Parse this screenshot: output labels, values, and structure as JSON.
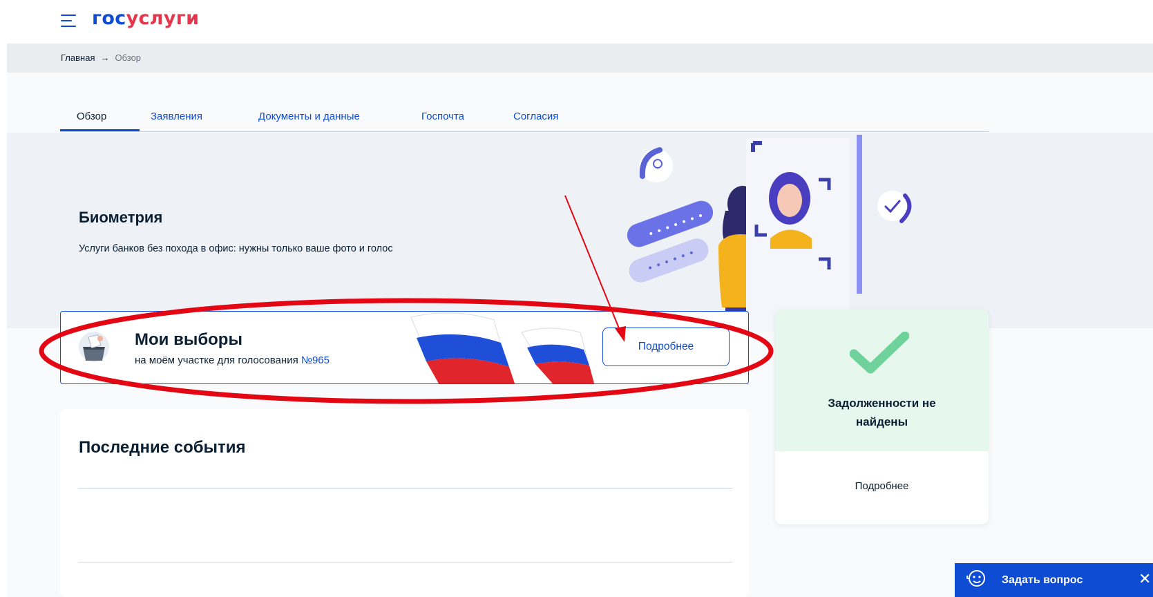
{
  "header": {
    "logo_part1": "гос",
    "logo_part2": "услуги",
    "menu_icon": "burger-menu-icon"
  },
  "breadcrumb": {
    "home": "Главная",
    "separator": "→",
    "current": "Обзор"
  },
  "tabs": [
    {
      "label": "Обзор",
      "active": true
    },
    {
      "label": "Заявления"
    },
    {
      "label": "Документы и данные"
    },
    {
      "label": "Госпочта"
    },
    {
      "label": "Согласия"
    }
  ],
  "banner": {
    "title": "Биометрия",
    "subtitle": "Услуги банков без похода в офис: нужны только ваше фото и голос"
  },
  "elections": {
    "title": "Мои выборы",
    "subtitle": "на моём участке для голосования ",
    "precinct": "№965",
    "button": "Подробнее"
  },
  "events": {
    "title": "Последние события"
  },
  "debt": {
    "title_line1": "Задолженности не",
    "title_line2": "найдены",
    "more": "Подробнее"
  },
  "chat": {
    "label": "Задать вопрос",
    "close": "✕"
  },
  "colors": {
    "brand_blue": "#0d4cd3",
    "brand_red": "#e4374e",
    "success_green": "#6fd29a",
    "annotation_red": "#e30613"
  }
}
